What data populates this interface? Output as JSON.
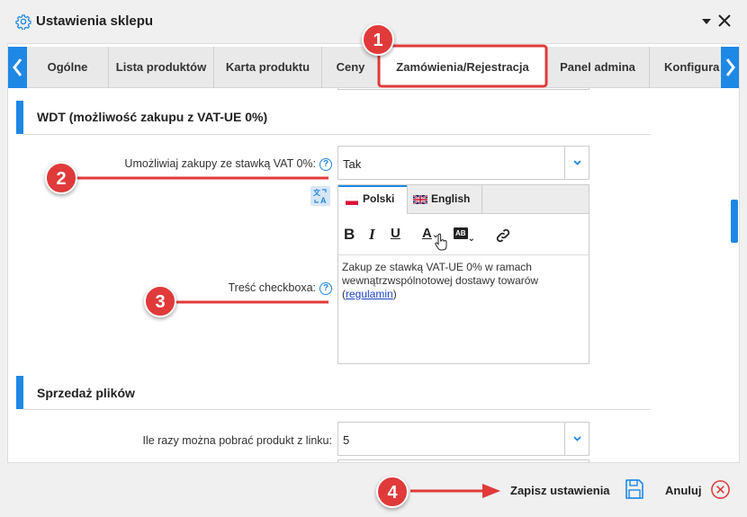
{
  "window": {
    "title": "Ustawienia sklepu",
    "icons": {
      "settings": "gear-icon",
      "collapse": "chevron-down-icon",
      "close": "close-icon"
    }
  },
  "tabs": [
    {
      "label": "Ogólne"
    },
    {
      "label": "Lista produktów"
    },
    {
      "label": "Karta produktu"
    },
    {
      "label": "Ceny"
    },
    {
      "label": "Zamówienia/Rejestracja",
      "active": true
    },
    {
      "label": "Panel admina"
    },
    {
      "label": "Konfigura"
    }
  ],
  "sections": {
    "wdt": {
      "title": "WDT (możliwość zakupu z VAT-UE 0%)",
      "vat_label": "Umożliwiaj zakupy ze stawką VAT 0%:",
      "vat_value": "Tak",
      "checkbox_label": "Treść checkboxa:",
      "languages": [
        {
          "label": "Polski",
          "active": true
        },
        {
          "label": "English",
          "active": false
        }
      ],
      "toolbar": {
        "bold": "B",
        "italic": "I",
        "underline": "U",
        "font_color": "A",
        "highlight": "AB"
      },
      "editor_text_before": "Zakup ze stawką VAT-UE 0% w ramach wewnątrzwspólnotowej dostawy towarów (",
      "editor_link": "regulamin",
      "editor_text_after": ")"
    },
    "files": {
      "title": "Sprzedaż plików",
      "downloads_label": "Ile razy można pobrać produkt z linku:",
      "downloads_value": "5"
    }
  },
  "help_glyph": "?",
  "footer": {
    "save_label": "Zapisz ustawienia",
    "cancel_label": "Anuluj"
  },
  "annotations": [
    "1",
    "2",
    "3",
    "4"
  ],
  "colors": {
    "accent": "#1e88e5",
    "callout": "#e03a3a"
  }
}
